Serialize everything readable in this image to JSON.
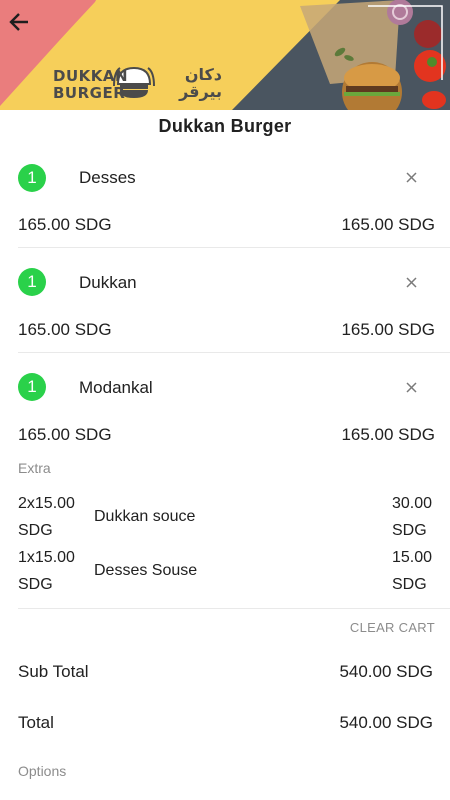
{
  "restaurant": {
    "name": "Dukkan Burger",
    "logo_text_en_line1": "DUKKAN",
    "logo_text_en_line2": "BURGER",
    "logo_text_ar_line1": "دكان",
    "logo_text_ar_line2": "بيرقر"
  },
  "header": {
    "back_icon": "arrow-left-icon"
  },
  "cart_items": [
    {
      "qty": "1",
      "name": "Desses",
      "unit_price": "165.00 SDG",
      "line_total": "165.00 SDG"
    },
    {
      "qty": "1",
      "name": "Dukkan",
      "unit_price": "165.00 SDG",
      "line_total": "165.00 SDG"
    },
    {
      "qty": "1",
      "name": "Modankal",
      "unit_price": "165.00 SDG",
      "line_total": "165.00 SDG"
    }
  ],
  "extras": {
    "label": "Extra",
    "items": [
      {
        "unit": "2x15.00",
        "unit_currency": "SDG",
        "name": "Dukkan souce",
        "price": "30.00",
        "price_currency": "SDG"
      },
      {
        "unit": "1x15.00",
        "unit_currency": "SDG",
        "name": "Desses Souse",
        "price": "15.00",
        "price_currency": "SDG"
      }
    ]
  },
  "actions": {
    "clear_cart": "CLEAR CART"
  },
  "summary": {
    "subtotal_label": "Sub Total",
    "subtotal_value": "540.00 SDG",
    "total_label": "Total",
    "total_value": "540.00 SDG"
  },
  "options": {
    "label": "Options"
  },
  "colors": {
    "qty_badge": "#2ad14a",
    "banner_yellow": "#f6cf5a",
    "banner_pink": "#ea7d7d",
    "banner_dark": "#4a5560",
    "muted_text": "#8c8c8c"
  }
}
